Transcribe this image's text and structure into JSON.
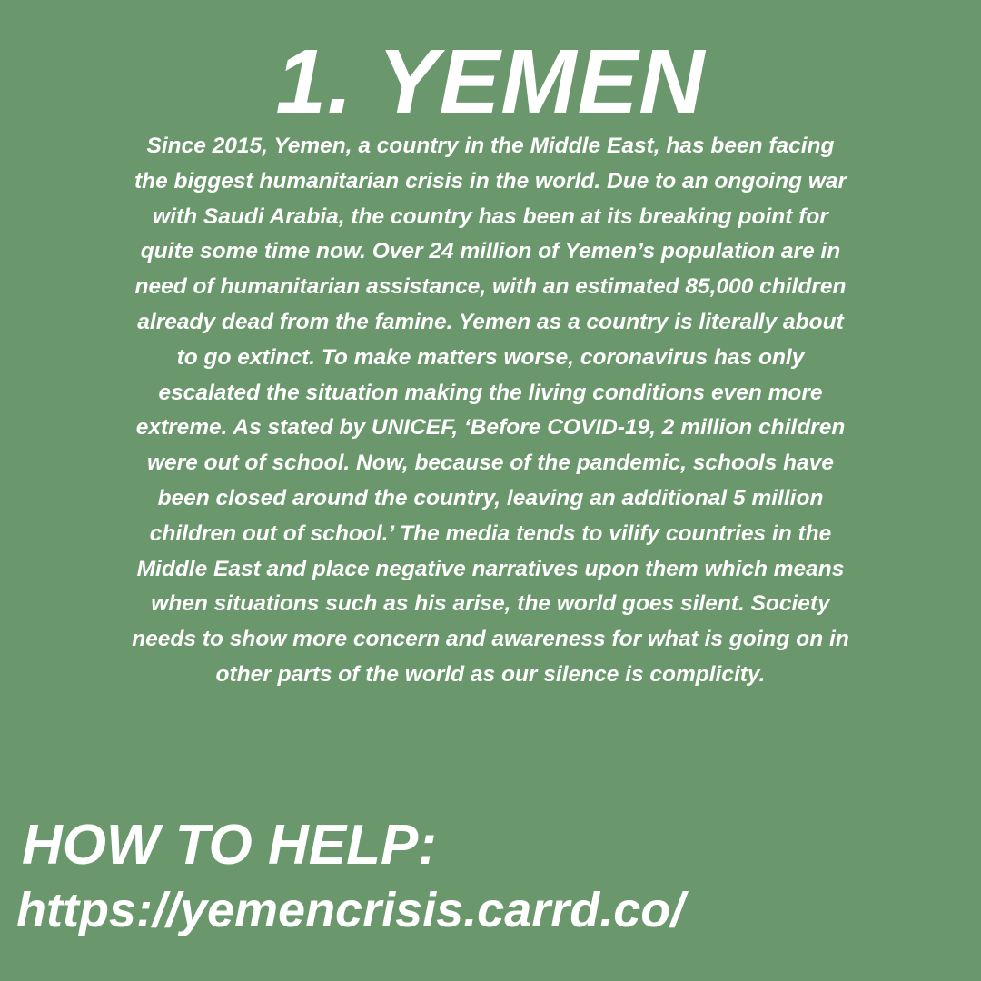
{
  "title": "1. YEMEN",
  "body": "Since 2015, Yemen, a country in the Middle East, has been facing the biggest humanitarian crisis in the world. Due to an ongoing war with Saudi Arabia, the country has been at its breaking point for quite some time now. Over 24 million of Yemen’s population are in need of humanitarian assistance, with an estimated 85,000 children already dead from the famine. Yemen as a country is literally about to go extinct. To make matters worse, coronavirus has only escalated the situation making the living conditions even more extreme. As stated by UNICEF, ‘Before COVID-19, 2 million children were out of school. Now, because of the pandemic, schools have been closed around the country, leaving an additional 5 million children out of school.’ The media tends to vilify countries in the Middle East and place negative narratives upon them which means when situations such as his arise, the world goes silent. Society needs to show more concern and awareness for what is going on in other parts of the world as our silence is complicity.",
  "help": {
    "heading": "HOW TO HELP:",
    "link": "https://yemencrisis.carrd.co/"
  },
  "colors": {
    "background": "#6a976c",
    "text": "#ffffff"
  }
}
